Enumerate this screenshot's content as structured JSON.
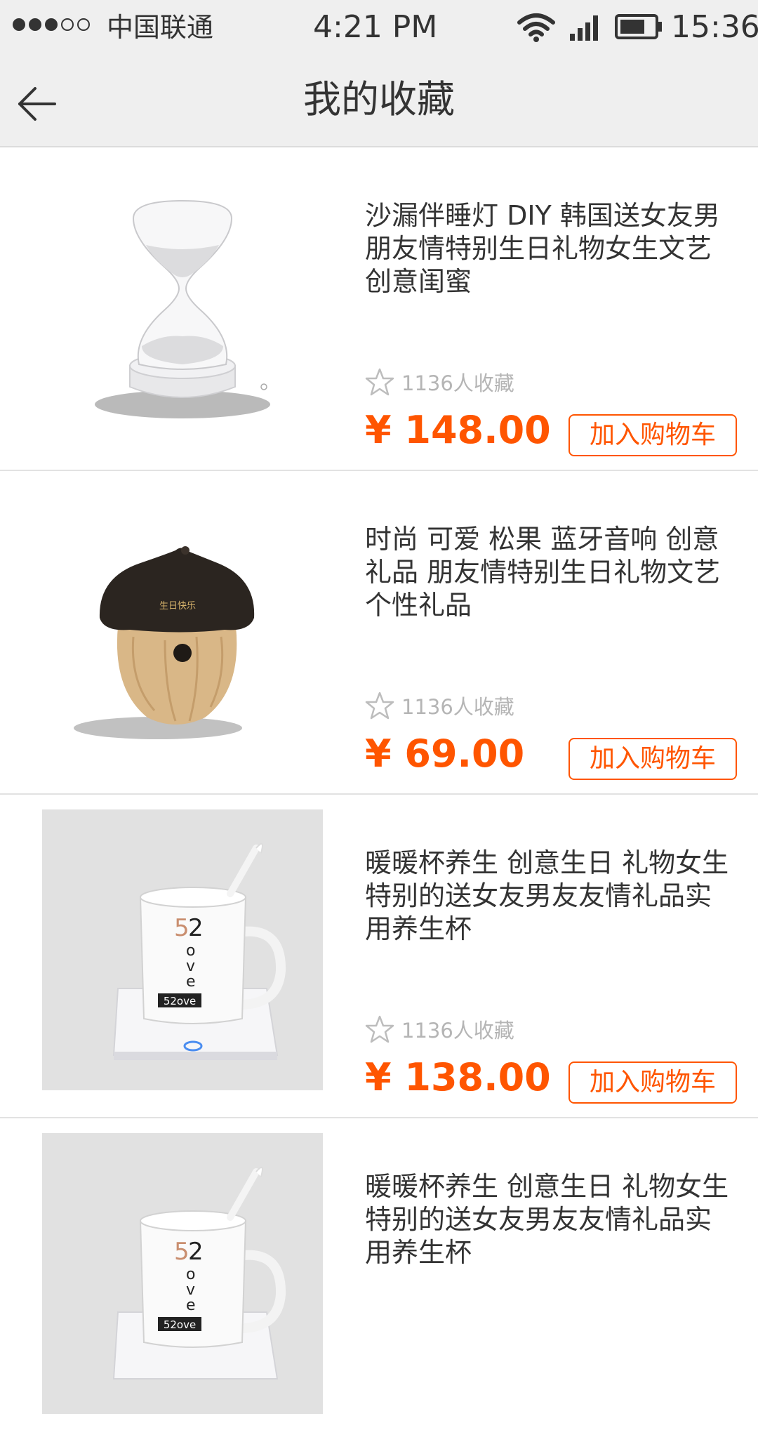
{
  "status_bar": {
    "carrier": "中国联通",
    "time_center": "4:21 PM",
    "time_right": "15:36",
    "signal_dots_filled": 3,
    "signal_dots_total": 5,
    "icons": [
      "wifi-icon",
      "cellular-signal-icon",
      "battery-icon"
    ]
  },
  "header": {
    "title": "我的收藏",
    "back_icon": "back-arrow-icon"
  },
  "colors": {
    "accent": "#ff5500",
    "header_bg": "#efefef",
    "muted_text": "#b5b5b5"
  },
  "products": [
    {
      "name": "沙漏伴睡灯 DIY 韩国送女友男朋友情特别生日礼物女生文艺创意闺蜜",
      "favorites": "1136人收藏",
      "price": "¥ 148.00",
      "cart_label": "加入购物车",
      "image": "hourglass-lamp-image"
    },
    {
      "name": "时尚 可爱 松果 蓝牙音响 创意礼品 朋友情特别生日礼物文艺个性礼品",
      "favorites": "1136人收藏",
      "price": "¥ 69.00",
      "cart_label": "加入购物车",
      "image": "acorn-speaker-image",
      "image_text": "生日快乐"
    },
    {
      "name": "暖暖杯养生 创意生日 礼物女生特别的送女友男友友情礼品实用养生杯",
      "favorites": "1136人收藏",
      "price": "¥ 138.00",
      "cart_label": "加入购物车",
      "image": "warming-mug-image",
      "image_text": "52ove"
    },
    {
      "name": "暖暖杯养生 创意生日 礼物女生特别的送女友男友友情礼品实用养生杯",
      "image": "warming-mug-image",
      "image_text": "52ove"
    }
  ]
}
